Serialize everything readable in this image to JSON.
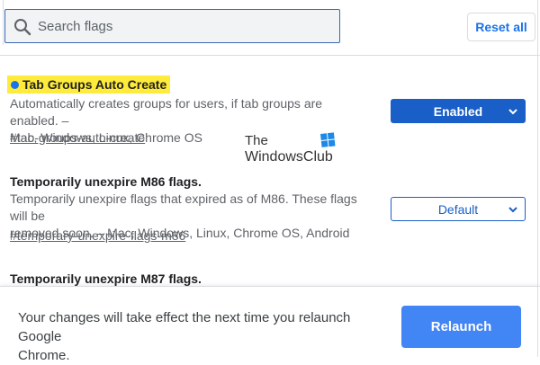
{
  "search": {
    "placeholder": "Search flags"
  },
  "toolbar": {
    "reset_label": "Reset all"
  },
  "experiments": [
    {
      "title": "Tab Groups Auto Create",
      "description_line1": "Automatically creates groups for users, if tab groups are enabled. –",
      "description_line2": "Mac, Windows, Linux, Chrome OS",
      "link": "#tab-groups-auto-create",
      "select_value": "Enabled",
      "highlighted": true
    },
    {
      "title": "Temporarily unexpire M86 flags.",
      "description_line1": "Temporarily unexpire flags that expired as of M86. These flags will be",
      "description_line2": "removed soon. – Mac, Windows, Linux, Chrome OS, Android",
      "link": "#temporary-unexpire-flags-m86",
      "select_value": "Default",
      "highlighted": false
    },
    {
      "title": "Temporarily unexpire M87 flags.",
      "highlighted": false
    }
  ],
  "watermark": {
    "line1": "The",
    "line2": "WindowsClub"
  },
  "footer": {
    "message_line1": "Your changes will take effect the next time you relaunch Google",
    "message_line2": "Chrome.",
    "relaunch_label": "Relaunch"
  },
  "colors": {
    "accent": "#1a73e8",
    "enabled_select": "#1a5fc7",
    "relaunch_button": "#4285f4",
    "highlight": "#ffeb3b"
  }
}
